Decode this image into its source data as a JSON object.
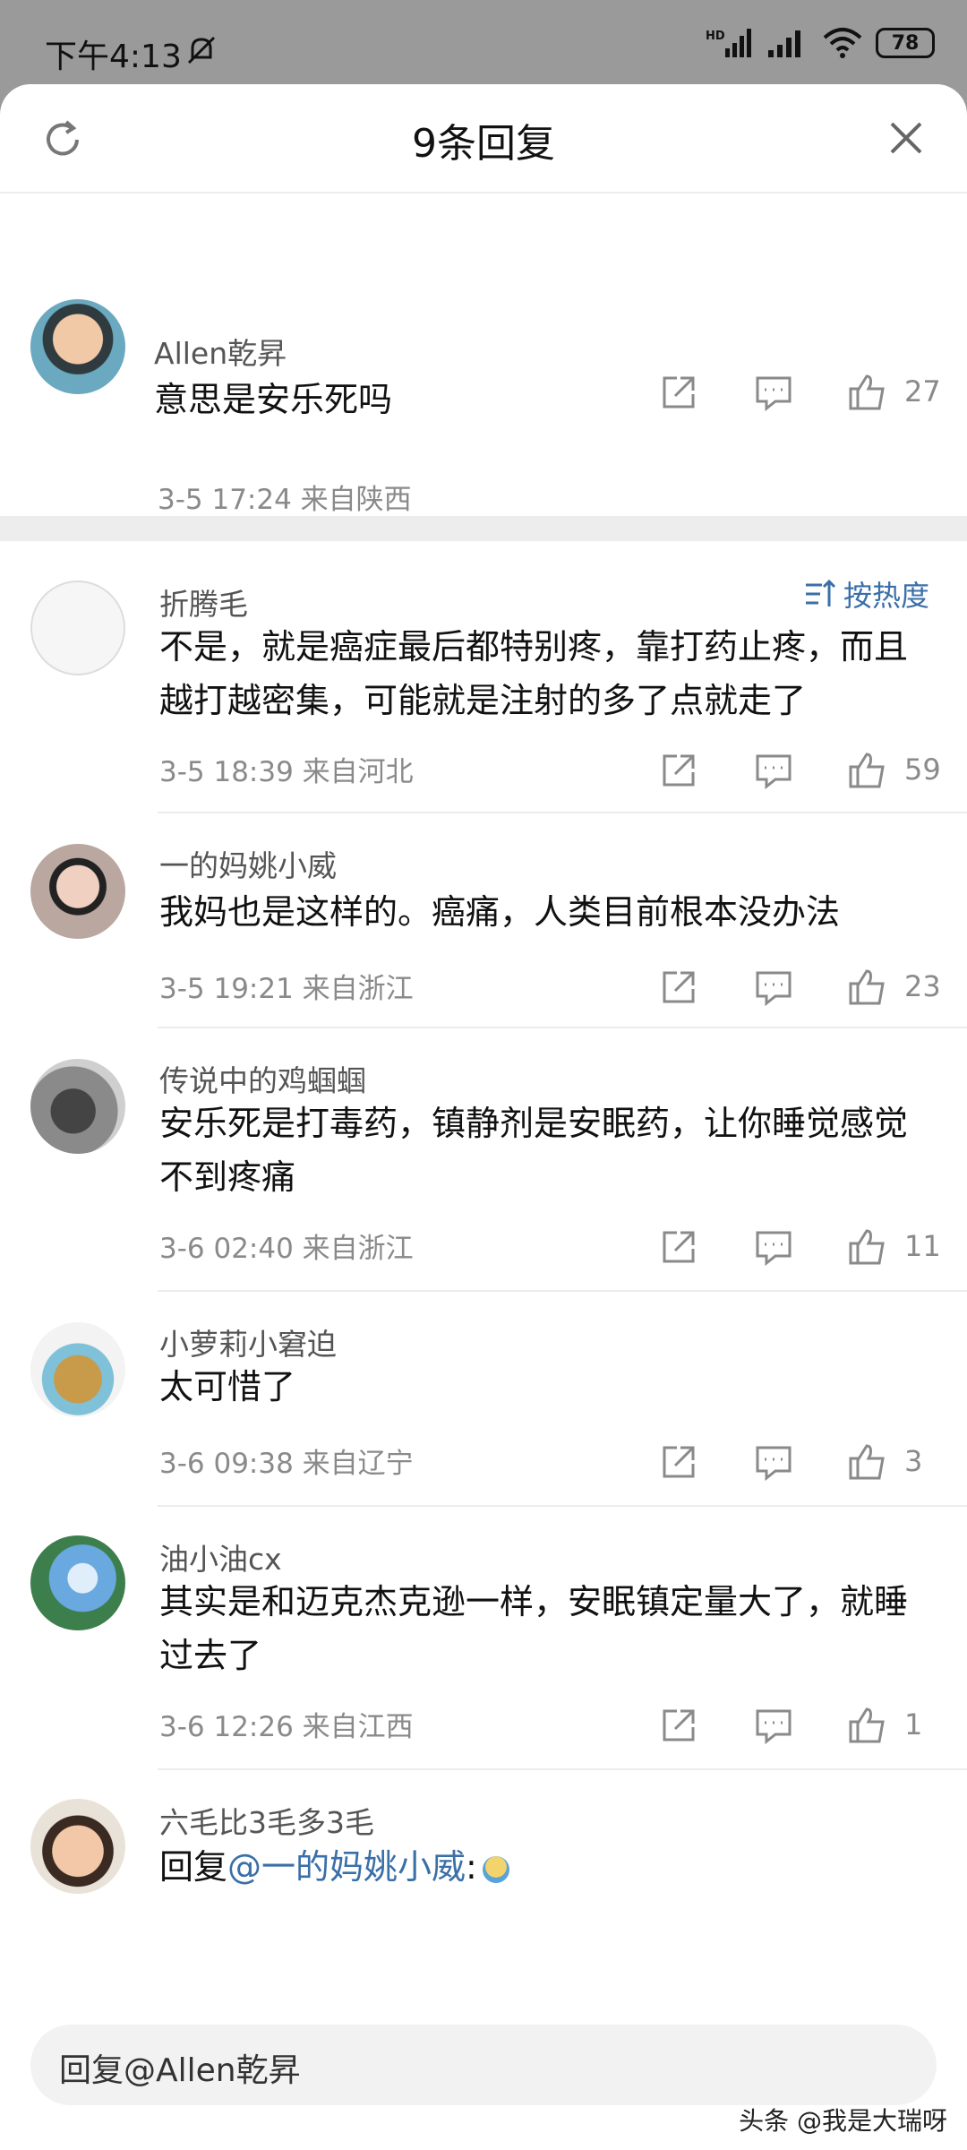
{
  "status": {
    "time": "下午4:13",
    "battery": "78"
  },
  "header": {
    "title": "9条回复"
  },
  "root_comment": {
    "user": "Allen乾昇",
    "text": "意思是安乐死吗",
    "meta": "3-5 17:24  来自陕西",
    "likes": "27"
  },
  "sort_label": "按热度",
  "comments": [
    {
      "user": "折腾毛",
      "text": "不是，就是癌症最后都特别疼，靠打药止疼，而且越打越密集，可能就是注射的多了点就走了",
      "meta": "3-5 18:39  来自河北",
      "likes": "59"
    },
    {
      "user": "一的妈姚小威",
      "text": "我妈也是这样的。癌痛，人类目前根本没办法",
      "meta": "3-5 19:21  来自浙江",
      "likes": "23"
    },
    {
      "user": "传说中的鸡蝈蝈",
      "text": "安乐死是打毒药，镇静剂是安眠药，让你睡觉感觉不到疼痛",
      "meta": "3-6 02:40  来自浙江",
      "likes": "11"
    },
    {
      "user": "小萝莉小窘迫",
      "text": "太可惜了",
      "meta": "3-6 09:38  来自辽宁",
      "likes": "3"
    },
    {
      "user": "油小油cx",
      "text": "其实是和迈克杰克逊一样，安眠镇定量大了，就睡过去了",
      "meta": "3-6 12:26  来自江西",
      "likes": "1"
    },
    {
      "user": "六毛比3毛多3毛",
      "reply_prefix": "回复",
      "mention": "@一的妈姚小威",
      "reply_suffix": ":"
    }
  ],
  "reply_input": {
    "placeholder": "回复@Allen乾昇"
  },
  "watermark": "头条 @我是大瑞呀"
}
